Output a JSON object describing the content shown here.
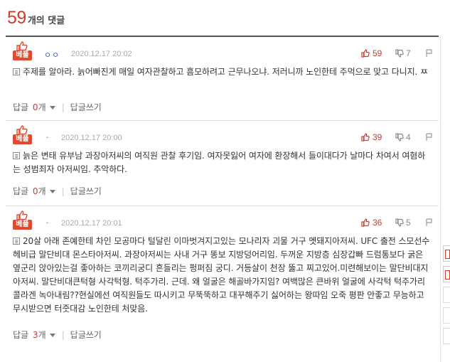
{
  "header": {
    "count": "59",
    "label": "개의 댓글"
  },
  "comments": [
    {
      "badge": "베플",
      "nickname": "ㅇㅇ",
      "date": "2020.12.17 20:02",
      "up": "59",
      "down": "7",
      "text": "주제를 알아라. 늙어빠진게 매일 여자관찰하고 흠모하려고 근무나오냐. 저러니까 노인한테 주먹으로 맞고 다니지. ㅉ",
      "reply_label": "답글",
      "reply_count": "0",
      "reply_unit": "개",
      "write_reply": "답글쓰기"
    },
    {
      "badge": "베플",
      "nickname": "·",
      "date": "2020.12.17 20:00",
      "up": "39",
      "down": "4",
      "text": "늙은 변태 유부남 과장아저씨의 여직원 관찰 후기임. 여자못잃어 여자에 환장해서 들이대다가 날마다 차여서 여혐하는 성범죄자 아저씨임. 추악하다.",
      "reply_label": "답글",
      "reply_count": "0",
      "reply_unit": "개",
      "write_reply": "답글쓰기"
    },
    {
      "badge": "베플",
      "nickname": "·",
      "date": "2020.12.17 20:01",
      "up": "36",
      "down": "5",
      "text": "20살 아래 존예한테 차인 모공마다 털달린 이마벗겨지고있는 모나리자 괴물 거구 멧돼지아저씨. UFC 출전 스모선수 헤비급 말단비대 몬스타아저씨. 과장아저씨는 사내 거구 똥보 지방덩어리임. 두꺼운 지방층 심장갑빠 드럼통보다 굵은 옆군리 앉아있는걸 좋아하는 코끼리궁디 흔들리는 펑퍼짐 궁디. 거등살이 천장 뚫고 찌고있어.미련해보이는 말단비대지아저씨. 말단비대큰턱형 사각턱형. 턱주가리. 근데. 왜 얼굴은 해골바가지임? 여백많은 큰바위 얼굴에 사각턱 턱주가리 콜라겐 녹아내림??현실에선 여직원들도 따시키고 무뚝뚝하고 대꾸해주기 싫어하는 왕따임 오죽 평판 안좋고 무능하고 무시받으면 터줏대감 노인한테 처맞음.",
      "reply_label": "답글",
      "reply_count": "3",
      "reply_unit": "개",
      "write_reply": "답글쓰기"
    }
  ],
  "icons": {
    "thumb": "thumbs-up-icon",
    "up": "thumbs-up-icon",
    "down": "thumbs-down-icon",
    "report": "report-icon",
    "doc": "document-icon"
  },
  "colors": {
    "accent": "#d33a2c",
    "badge": "#e04a2f",
    "nickname": "#3a5fb0"
  }
}
